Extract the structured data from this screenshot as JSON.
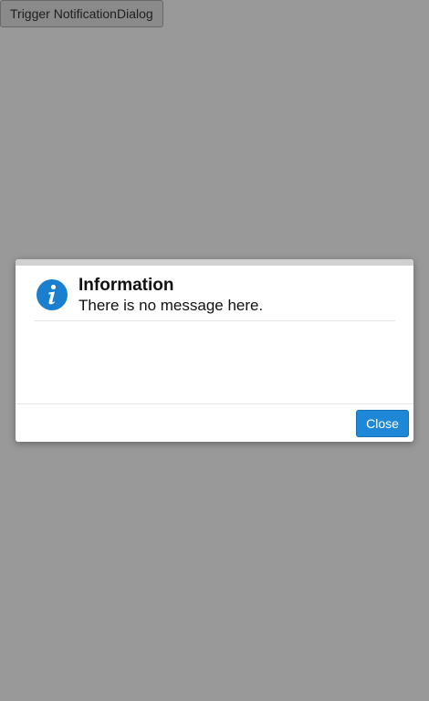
{
  "trigger": {
    "label": "Trigger NotificationDialog"
  },
  "dialog": {
    "title": "Information",
    "message": "There is no message here.",
    "icon": "info-icon",
    "close_label": "Close"
  },
  "colors": {
    "overlay": "#979797",
    "primary_button": "#1e88d6",
    "info_icon": "#1a7fcf"
  }
}
